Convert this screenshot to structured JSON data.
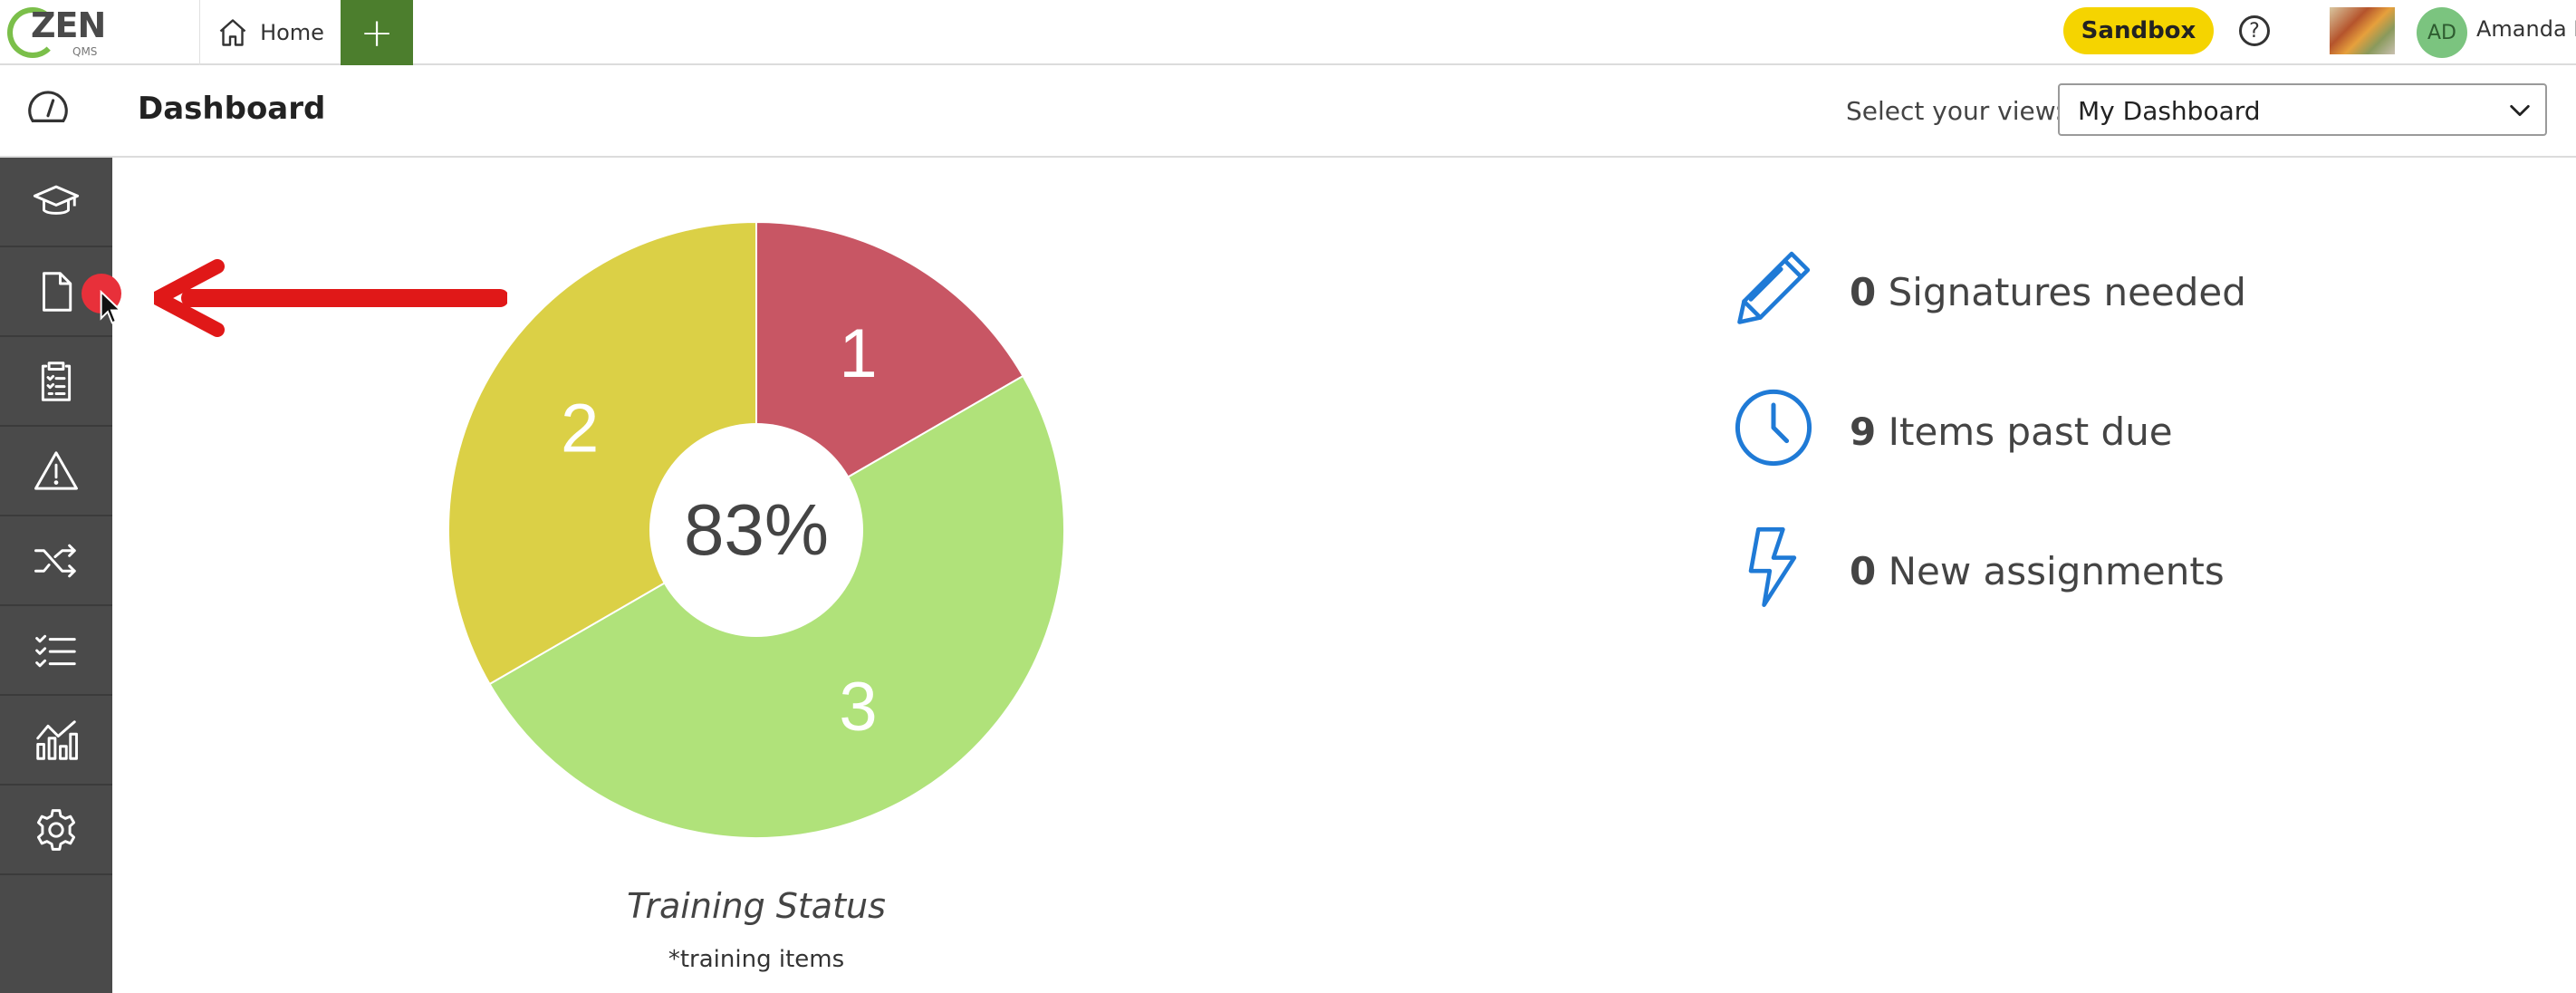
{
  "header": {
    "logo_text": "ZEN",
    "logo_sub": "QMS",
    "home_tab_label": "Home",
    "add_tab_label": "+",
    "sandbox_label": "Sandbox",
    "help_label": "?",
    "user_initials": "AD",
    "user_name": "Amanda D"
  },
  "subheader": {
    "title": "Dashboard",
    "view_label": "Select your view:",
    "view_value": "My Dashboard"
  },
  "sidebar": {
    "items": [
      {
        "icon": "graduation-cap-icon"
      },
      {
        "icon": "document-icon"
      },
      {
        "icon": "clipboard-checklist-icon"
      },
      {
        "icon": "warning-triangle-icon"
      },
      {
        "icon": "shuffle-icon"
      },
      {
        "icon": "checklist-icon"
      },
      {
        "icon": "analytics-chart-icon"
      },
      {
        "icon": "gear-icon"
      }
    ]
  },
  "chart_data": {
    "type": "pie",
    "title": "Training Status",
    "subtitle": "*training items",
    "center_label": "83%",
    "slices": [
      {
        "label": "1",
        "value": 1,
        "color": "#c85664"
      },
      {
        "label": "3",
        "value": 3,
        "color": "#b0e27a"
      },
      {
        "label": "2",
        "value": 2,
        "color": "#dbd046"
      }
    ]
  },
  "stats": {
    "signatures": {
      "count": "0",
      "label": "Signatures needed"
    },
    "past_due": {
      "count": "9",
      "label": "Items past due"
    },
    "assignments": {
      "count": "0",
      "label": "New assignments"
    }
  },
  "colors": {
    "accent_blue": "#1f7ad6",
    "sandbox_yellow": "#f5d400",
    "add_green": "#4c7e2d",
    "sidebar_bg": "#4a4a4a",
    "annotation_red": "#e01818"
  }
}
